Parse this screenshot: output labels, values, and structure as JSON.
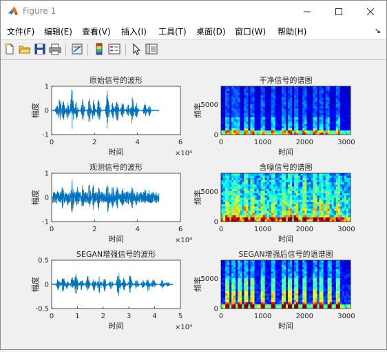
{
  "window": {
    "title": "Figure 1",
    "controls": [
      "minimize",
      "maximize",
      "close"
    ]
  },
  "menu": {
    "items": [
      "文件(F)",
      "编辑(E)",
      "查看(V)",
      "插入(I)",
      "工具(T)",
      "桌面(D)",
      "窗口(W)",
      "帮助(H)"
    ],
    "overflow_glyph": "↘"
  },
  "toolbar": {
    "icons": [
      "new-figure-icon",
      "open-file-icon",
      "save-icon",
      "print-icon",
      "link-plot-icon",
      "insert-colorbar-icon",
      "insert-legend-icon",
      "pointer-icon",
      "property-editor-icon"
    ]
  },
  "chart_data": [
    {
      "type": "line",
      "title": "原始信号的波形",
      "xlabel": "时间",
      "ylabel": "幅度",
      "xlim": [
        0,
        6
      ],
      "ylim": [
        -1,
        1
      ],
      "xticks": [
        "0",
        "2",
        "4",
        "6"
      ],
      "yticks": [
        "-1",
        "0",
        "1"
      ],
      "x_exponent": "×10⁴",
      "signal_end": 5.0,
      "bursts": [
        [
          0.25,
          0.25
        ],
        [
          0.38,
          0.6
        ],
        [
          0.55,
          0.45
        ],
        [
          0.75,
          0.4
        ],
        [
          0.95,
          0.9
        ],
        [
          1.15,
          0.45
        ],
        [
          1.45,
          0.55
        ],
        [
          1.75,
          0.5
        ],
        [
          1.95,
          0.55
        ],
        [
          2.2,
          0.6
        ],
        [
          2.6,
          0.85
        ],
        [
          2.85,
          0.4
        ],
        [
          3.05,
          0.55
        ],
        [
          3.3,
          0.4
        ],
        [
          3.55,
          0.3
        ],
        [
          3.75,
          0.6
        ],
        [
          3.95,
          0.35
        ],
        [
          4.35,
          0.3
        ],
        [
          4.55,
          0.25
        ]
      ]
    },
    {
      "type": "heatmap",
      "title": "干净信号的谱图",
      "xlabel": "时间",
      "ylabel": "频率",
      "xlim": [
        0,
        3100
      ],
      "ylim": [
        0,
        8000
      ],
      "xticks": [
        "0",
        "1000",
        "2000",
        "3000"
      ],
      "yticks": [
        "0",
        "5000"
      ],
      "colormap": "jet",
      "noise_level": 0.12,
      "stripes": [
        160,
        300,
        420,
        600,
        760,
        1000,
        1250,
        1500,
        1650,
        1820,
        2000,
        2230,
        2400,
        2560,
        2800
      ]
    },
    {
      "type": "line",
      "title": "观测信号的波形",
      "xlabel": "时间",
      "ylabel": "幅度",
      "xlim": [
        0,
        6
      ],
      "ylim": [
        -1,
        1
      ],
      "xticks": [
        "0",
        "2",
        "4",
        "6"
      ],
      "yticks": [
        "-1",
        "0",
        "1"
      ],
      "x_exponent": "×10⁴",
      "signal_end": 5.0,
      "noise_floor": 0.22,
      "bursts": [
        [
          0.25,
          0.3
        ],
        [
          0.5,
          0.5
        ],
        [
          0.75,
          0.45
        ],
        [
          0.95,
          0.75
        ],
        [
          1.2,
          0.5
        ],
        [
          1.45,
          0.55
        ],
        [
          1.75,
          0.55
        ],
        [
          1.95,
          0.6
        ],
        [
          2.2,
          0.55
        ],
        [
          2.6,
          0.75
        ],
        [
          2.85,
          0.5
        ],
        [
          3.05,
          0.55
        ],
        [
          3.3,
          0.45
        ],
        [
          3.55,
          0.4
        ],
        [
          3.75,
          0.5
        ],
        [
          3.95,
          0.4
        ],
        [
          4.35,
          0.35
        ],
        [
          4.55,
          0.3
        ]
      ]
    },
    {
      "type": "heatmap",
      "title": "含噪信号的谱图",
      "xlabel": "时间",
      "ylabel": "频率",
      "xlim": [
        0,
        3100
      ],
      "ylim": [
        0,
        8000
      ],
      "xticks": [
        "0",
        "1000",
        "2000",
        "3000"
      ],
      "yticks": [
        "0",
        "5000"
      ],
      "colormap": "jet",
      "noise_level": 0.42,
      "stripes": [
        160,
        300,
        420,
        600,
        760,
        1000,
        1250,
        1500,
        1650,
        1820,
        2000,
        2230,
        2400,
        2560,
        2800
      ]
    },
    {
      "type": "line",
      "title": "SEGAN增强信号的波形",
      "xlabel": "时间",
      "ylabel": "幅度",
      "xlim": [
        0,
        5
      ],
      "ylim": [
        -0.5,
        0.5
      ],
      "xticks": [
        "0",
        "1",
        "2",
        "3",
        "4",
        "5"
      ],
      "yticks": [
        "-0.5",
        "0",
        "0.5"
      ],
      "x_exponent": "×10⁴",
      "signal_end": 4.7,
      "bursts": [
        [
          0.25,
          0.12
        ],
        [
          0.45,
          0.18
        ],
        [
          0.6,
          0.1
        ],
        [
          0.8,
          0.15
        ],
        [
          0.95,
          0.25
        ],
        [
          1.15,
          0.12
        ],
        [
          1.4,
          0.18
        ],
        [
          1.65,
          0.15
        ],
        [
          1.85,
          0.2
        ],
        [
          2.05,
          0.15
        ],
        [
          2.3,
          0.12
        ],
        [
          2.6,
          0.28
        ],
        [
          2.8,
          0.15
        ],
        [
          3.05,
          0.2
        ],
        [
          3.3,
          0.12
        ],
        [
          3.55,
          0.1
        ],
        [
          3.75,
          0.15
        ],
        [
          3.95,
          0.12
        ],
        [
          4.3,
          0.1
        ],
        [
          4.5,
          0.08
        ]
      ]
    },
    {
      "type": "heatmap",
      "title": "SEGAN增强后信号的语谱图",
      "xlabel": "时间",
      "ylabel": "频率",
      "xlim": [
        0,
        3100
      ],
      "ylim": [
        0,
        8000
      ],
      "xticks": [
        "0",
        "1000",
        "2000",
        "3000"
      ],
      "yticks": [
        "0",
        "5000"
      ],
      "colormap": "jet",
      "noise_level": 0.18,
      "strong_stripes": true,
      "stripes": [
        160,
        320,
        450,
        620,
        760,
        1000,
        1230,
        1480,
        1640,
        1820,
        2000,
        2230,
        2420,
        2580,
        2800
      ]
    }
  ]
}
